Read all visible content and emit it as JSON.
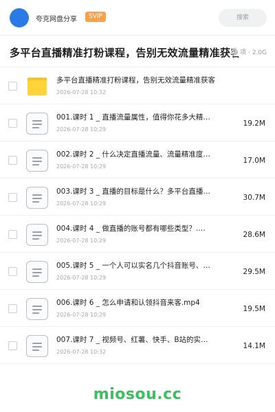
{
  "header": {
    "username": "夸克网盘分享",
    "badge": "SVIP",
    "search_placeholder": "搜索"
  },
  "share": {
    "title": "多平台直播精准打粉课程，告别无效流量精准获客",
    "meta": "9 项 · 2.0G"
  },
  "items": [
    {
      "type": "folder",
      "name": "多平台直播精准打粉课程，告别无效流量精准获客",
      "date": "2026-07-28 10:32",
      "size": ""
    },
    {
      "type": "file",
      "name": "001.课时 1 _ 直播流量属性，值得你花多大精…",
      "date": "2026-07-28 10:29",
      "size": "19.2M"
    },
    {
      "type": "file",
      "name": "002.课时 2 _ 什么决定直播流量、流量精准度…",
      "date": "2026-07-28 10:29",
      "size": "17.0M"
    },
    {
      "type": "file",
      "name": "003.课时 3 _ 直播的目标是什么？多平台直播…",
      "date": "2026-07-28 10:29",
      "size": "30.7M"
    },
    {
      "type": "file",
      "name": "004.课时 4 _ 做直播的账号都有哪些类型？.…",
      "date": "2026-07-28 10:29",
      "size": "28.6M"
    },
    {
      "type": "file",
      "name": "005.课时 5 _ 一个人可以实名几个抖音账号、…",
      "date": "2026-07-28 10:29",
      "size": "29.5M"
    },
    {
      "type": "file",
      "name": "006.课时 6 _ 怎么申请和认领抖音来客.mp4",
      "date": "2026-07-28 10:29",
      "size": "19.5M"
    },
    {
      "type": "file",
      "name": "007.课时 7 _ 视频号、红薯、快手、B站的实…",
      "date": "2026-07-28 10:32",
      "size": "14.1M"
    }
  ],
  "watermark": "miosou.cc",
  "colors": {
    "avatar": "#2b7be6",
    "badge": "#f5a24a",
    "folder": "#ffd43b",
    "watermark": "#3bbf5c"
  }
}
